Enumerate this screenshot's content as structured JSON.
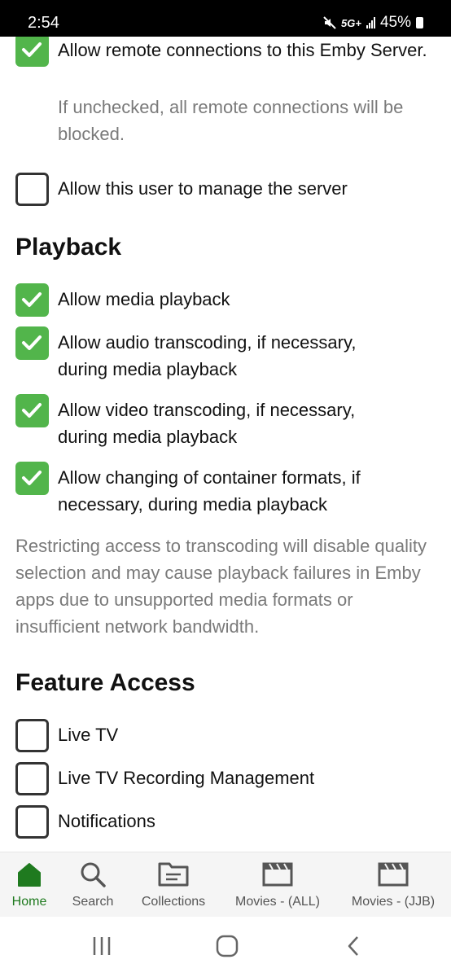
{
  "status_bar": {
    "time": "2:54",
    "network": "5G+",
    "battery": "45%"
  },
  "access": {
    "remote": {
      "label": "Allow remote connections to this Emby Server.",
      "helper": "If unchecked, all remote connections will be blocked.",
      "checked": true
    },
    "manage_server": {
      "label": "Allow this user to manage the server",
      "checked": false
    }
  },
  "playback": {
    "heading": "Playback",
    "items": [
      {
        "label": "Allow media playback",
        "checked": true
      },
      {
        "label": "Allow audio transcoding, if necessary, during media playback",
        "checked": true
      },
      {
        "label": "Allow video transcoding, if necessary, during media playback",
        "checked": true
      },
      {
        "label": "Allow changing of container formats, if necessary, during media playback",
        "checked": true
      }
    ],
    "note": "Restricting access to transcoding will disable quality selection and may cause playback failures in Emby apps due to unsupported media formats or insufficient network bandwidth."
  },
  "feature_access": {
    "heading": "Feature Access",
    "items": [
      {
        "label": "Live TV",
        "checked": false
      },
      {
        "label": "Live TV Recording Management",
        "checked": false
      },
      {
        "label": "Notifications",
        "checked": false
      }
    ]
  },
  "bottom_nav": {
    "items": [
      {
        "label": "Home",
        "icon": "home-icon",
        "active": true
      },
      {
        "label": "Search",
        "icon": "search-icon",
        "active": false
      },
      {
        "label": "Collections",
        "icon": "folder-icon",
        "active": false
      },
      {
        "label": "Movies - (ALL)",
        "icon": "movie-icon",
        "active": false
      },
      {
        "label": "Movies - (JJB)",
        "icon": "movie-icon",
        "active": false
      }
    ]
  },
  "colors": {
    "accent": "#52b54b",
    "active_nav": "#1f7a1f",
    "helper_text": "#7a7a7a"
  }
}
